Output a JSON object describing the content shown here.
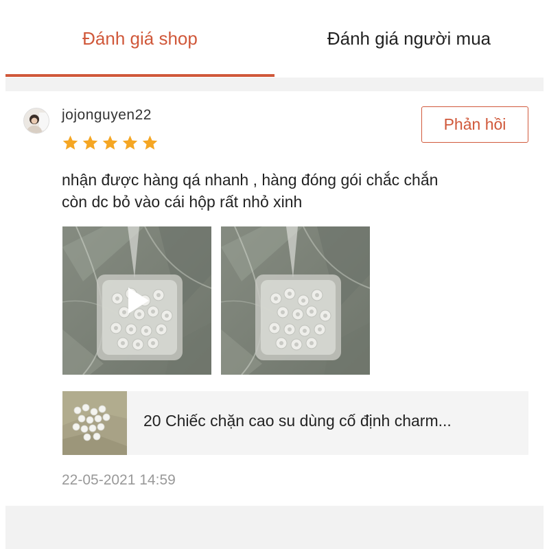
{
  "tabs": {
    "shop_label": "Đánh giá shop",
    "buyer_label": "Đánh giá người mua",
    "active_color": "#d0583a"
  },
  "review": {
    "username": "jojonguyen22",
    "rating": 5,
    "rating_max": 5,
    "reply_label": "Phản hồi",
    "comment_line1": "nhận được hàng qá nhanh , hàng đóng gói chắc chắn",
    "comment_line2": "còn dc bỏ vào cái hộp rất nhỏ xinh",
    "media": [
      {
        "type": "video",
        "icon": "play-icon"
      },
      {
        "type": "photo"
      }
    ],
    "product_name": "20 Chiếc chặn cao su dùng cố định charm...",
    "timestamp": "22-05-2021 14:59"
  },
  "colors": {
    "accent": "#d0583a",
    "star": "#f5a623",
    "separator": "#f2f2f2"
  }
}
